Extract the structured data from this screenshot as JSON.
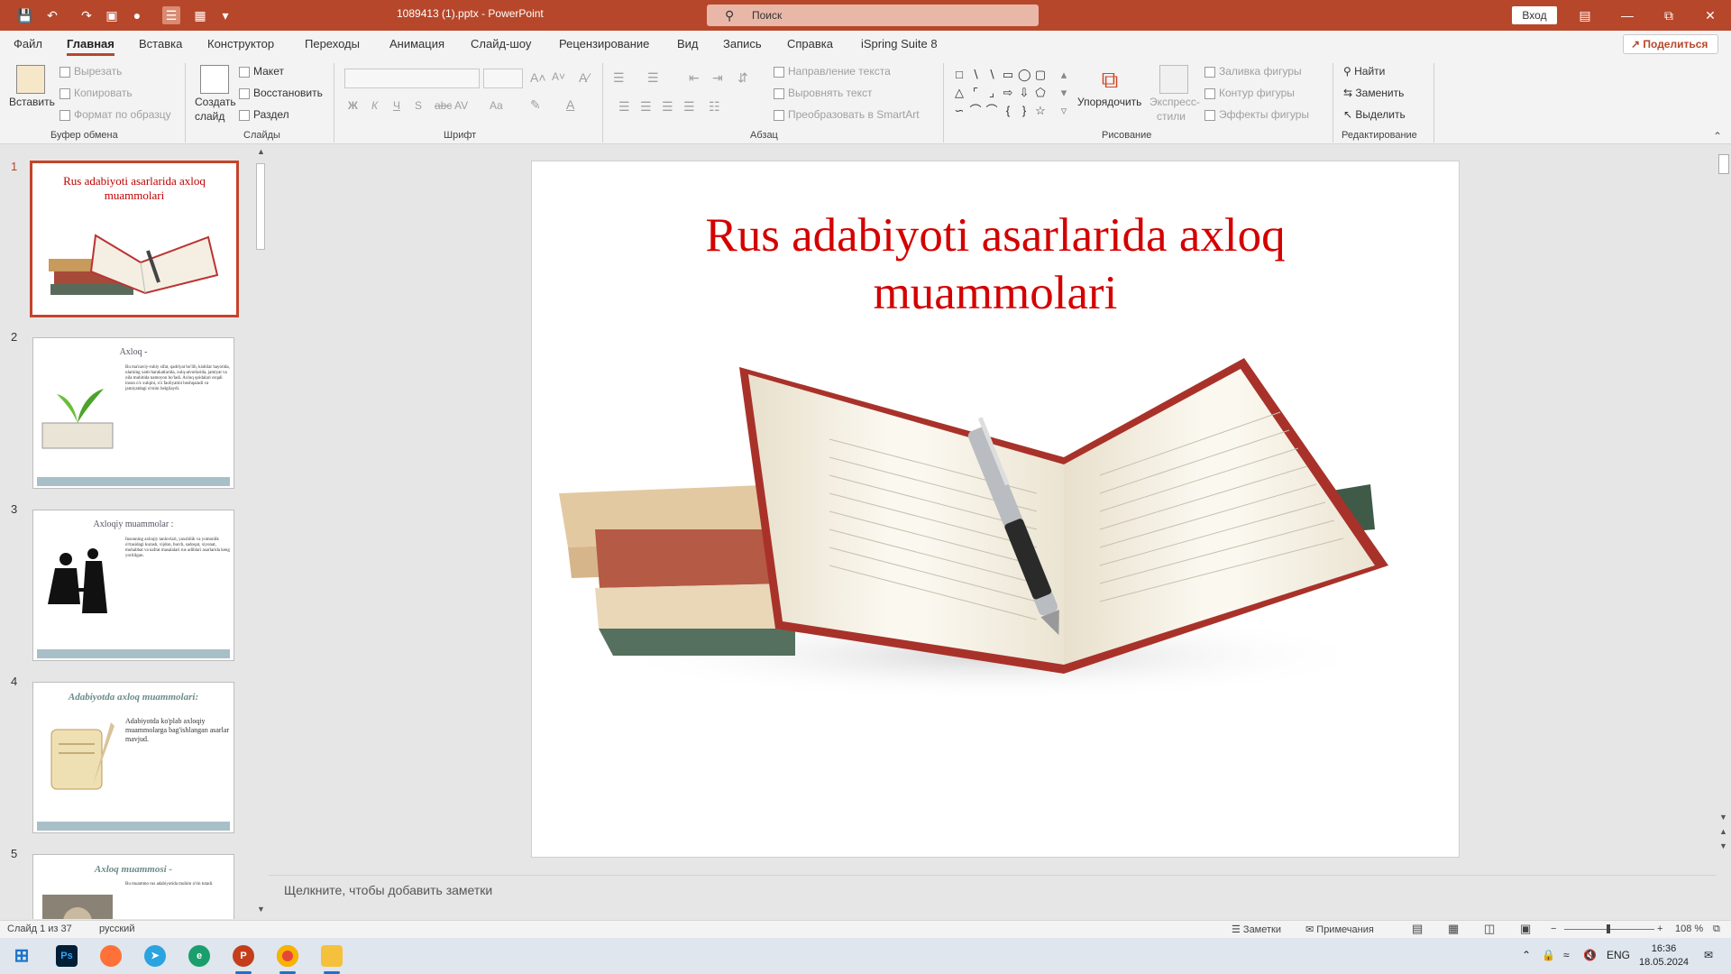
{
  "titlebar": {
    "doc_title": "1089413 (1).pptx  -  PowerPoint",
    "search_placeholder": "Поиск",
    "login": "Вход",
    "accent": "#b7472a"
  },
  "menu": {
    "tabs": [
      "Файл",
      "Главная",
      "Вставка",
      "Конструктор",
      "Переходы",
      "Анимация",
      "Слайд-шоу",
      "Рецензирование",
      "Вид",
      "Запись",
      "Справка",
      "iSpring Suite 8"
    ],
    "active": "Главная",
    "share": "Поделиться"
  },
  "ribbon": {
    "clipboard": {
      "paste": "Вставить",
      "cut": "Вырезать",
      "copy": "Копировать",
      "format_painter": "Формат по образцу",
      "label": "Буфер обмена"
    },
    "slides": {
      "new_slide_1": "Создать",
      "new_slide_2": "слайд",
      "layout": "Макет",
      "reset": "Восстановить",
      "section": "Раздел",
      "label": "Слайды"
    },
    "font": {
      "bold": "Ж",
      "italic": "К",
      "underline": "Ч",
      "shadow": "S",
      "strike": "abc",
      "spacing": "AV",
      "case": "Aa",
      "label": "Шрифт"
    },
    "paragraph": {
      "text_direction": "Направление текста",
      "align_text": "Выровнять текст",
      "smartart": "Преобразовать в SmartArt",
      "label": "Абзац"
    },
    "drawing": {
      "arrange": "Упорядочить",
      "quick_styles_1": "Экспресс-",
      "quick_styles_2": "стили",
      "shape_fill": "Заливка фигуры",
      "shape_outline": "Контур фигуры",
      "shape_effects": "Эффекты фигуры",
      "label": "Рисование"
    },
    "editing": {
      "find": "Найти",
      "replace": "Заменить",
      "select": "Выделить",
      "label": "Редактирование"
    }
  },
  "thumbnails": [
    {
      "num": "1",
      "title": "Rus adabiyoti asarlarida axloq muammolari"
    },
    {
      "num": "2",
      "title": "Axloq -",
      "text": "Bu ma'naviy-ruhiy sifat, qadriyat bo'lib, kishilar hayotida, ularning xatti-harakatlarida, xulq-atvorlarida, jamiyat va oila muhitida namoyon bo'ladi. Axloq qoidalari orqali inson o'z xulqini, o'z faoliyatini boshqaradi va jamiyatdagi o'rnini belgilaydi."
    },
    {
      "num": "3",
      "title": "Axloqiy muammolar :",
      "text": "Insonning axloqiy tanlovlari, yaxshilik va yomonlik o'rtasidagi kurash, vijdon, burch, sadoqat, xiyonat, muhabbat va nafrat masalalari rus adiblari asarlarida keng yoritilgan."
    },
    {
      "num": "4",
      "title": "Adabiyotda axloq muammolari:",
      "text": "Adabiyotda ko'plab axloqiy muammolarga bag'ishlangan asarlar mavjud."
    },
    {
      "num": "5",
      "title": "Axloq muammosi -",
      "text": "Bu muammo rus adabiyotida muhim o'rin tutadi."
    }
  ],
  "slide": {
    "title_line1": "Rus adabiyoti asarlarida axloq",
    "title_line2": "muammolari",
    "image": "books-with-pen"
  },
  "notes_placeholder": "Щелкните, чтобы добавить заметки",
  "status": {
    "slide_counter": "Слайд 1 из 37",
    "language": "русский",
    "notes": "Заметки",
    "comments": "Примечания",
    "zoom": "108 %"
  },
  "taskbar": {
    "apps": [
      "windows-start",
      "photoshop",
      "firefox",
      "telegram",
      "edge",
      "powerpoint",
      "chrome",
      "file-explorer"
    ],
    "lang": "ENG",
    "time": "16:36",
    "date": "18.05.2024"
  }
}
